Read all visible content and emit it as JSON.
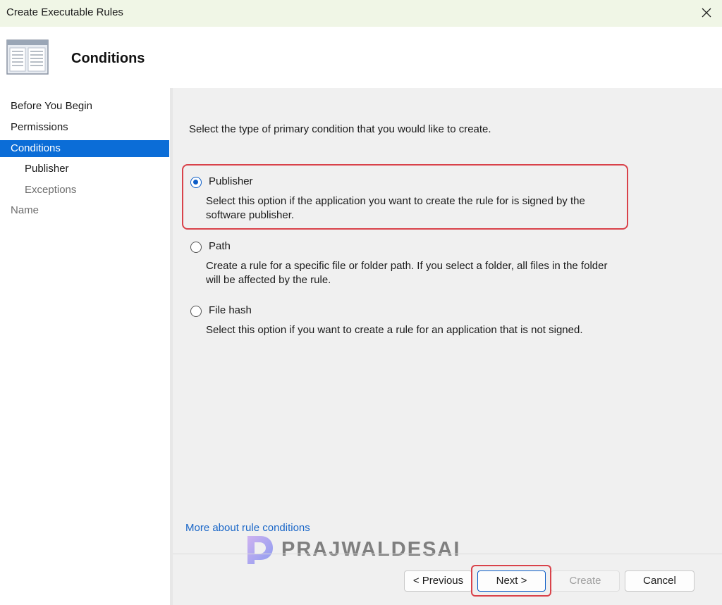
{
  "window": {
    "title": "Create Executable Rules"
  },
  "header": {
    "heading": "Conditions",
    "icon": "wizard-page-icon"
  },
  "sidebar": {
    "items": [
      {
        "label": "Before You Begin",
        "state": "normal"
      },
      {
        "label": "Permissions",
        "state": "normal"
      },
      {
        "label": "Conditions",
        "state": "active"
      },
      {
        "label": "Publisher",
        "state": "sub"
      },
      {
        "label": "Exceptions",
        "state": "sub-dim"
      },
      {
        "label": "Name",
        "state": "dim"
      }
    ]
  },
  "main": {
    "prompt": "Select the type of primary condition that you would like to create.",
    "options": [
      {
        "label": "Publisher",
        "selected": true,
        "description": "Select this option if the application you want to create the rule for is signed by the software publisher."
      },
      {
        "label": "Path",
        "selected": false,
        "description": "Create a rule for a specific file or folder path. If you select a folder, all files in the folder will be affected by the rule."
      },
      {
        "label": "File hash",
        "selected": false,
        "description": "Select this option if you want to create a rule for an application that is not signed."
      }
    ],
    "link": "More about rule conditions"
  },
  "watermark": {
    "text": "PRAJWALDESAI"
  },
  "footer": {
    "previous": "< Previous",
    "next": "Next >",
    "create": "Create",
    "cancel": "Cancel"
  },
  "colors": {
    "accent": "#0b6dd7",
    "highlight": "#d9424a",
    "link": "#1a67c8",
    "titlebar": "#f0f6e6"
  }
}
